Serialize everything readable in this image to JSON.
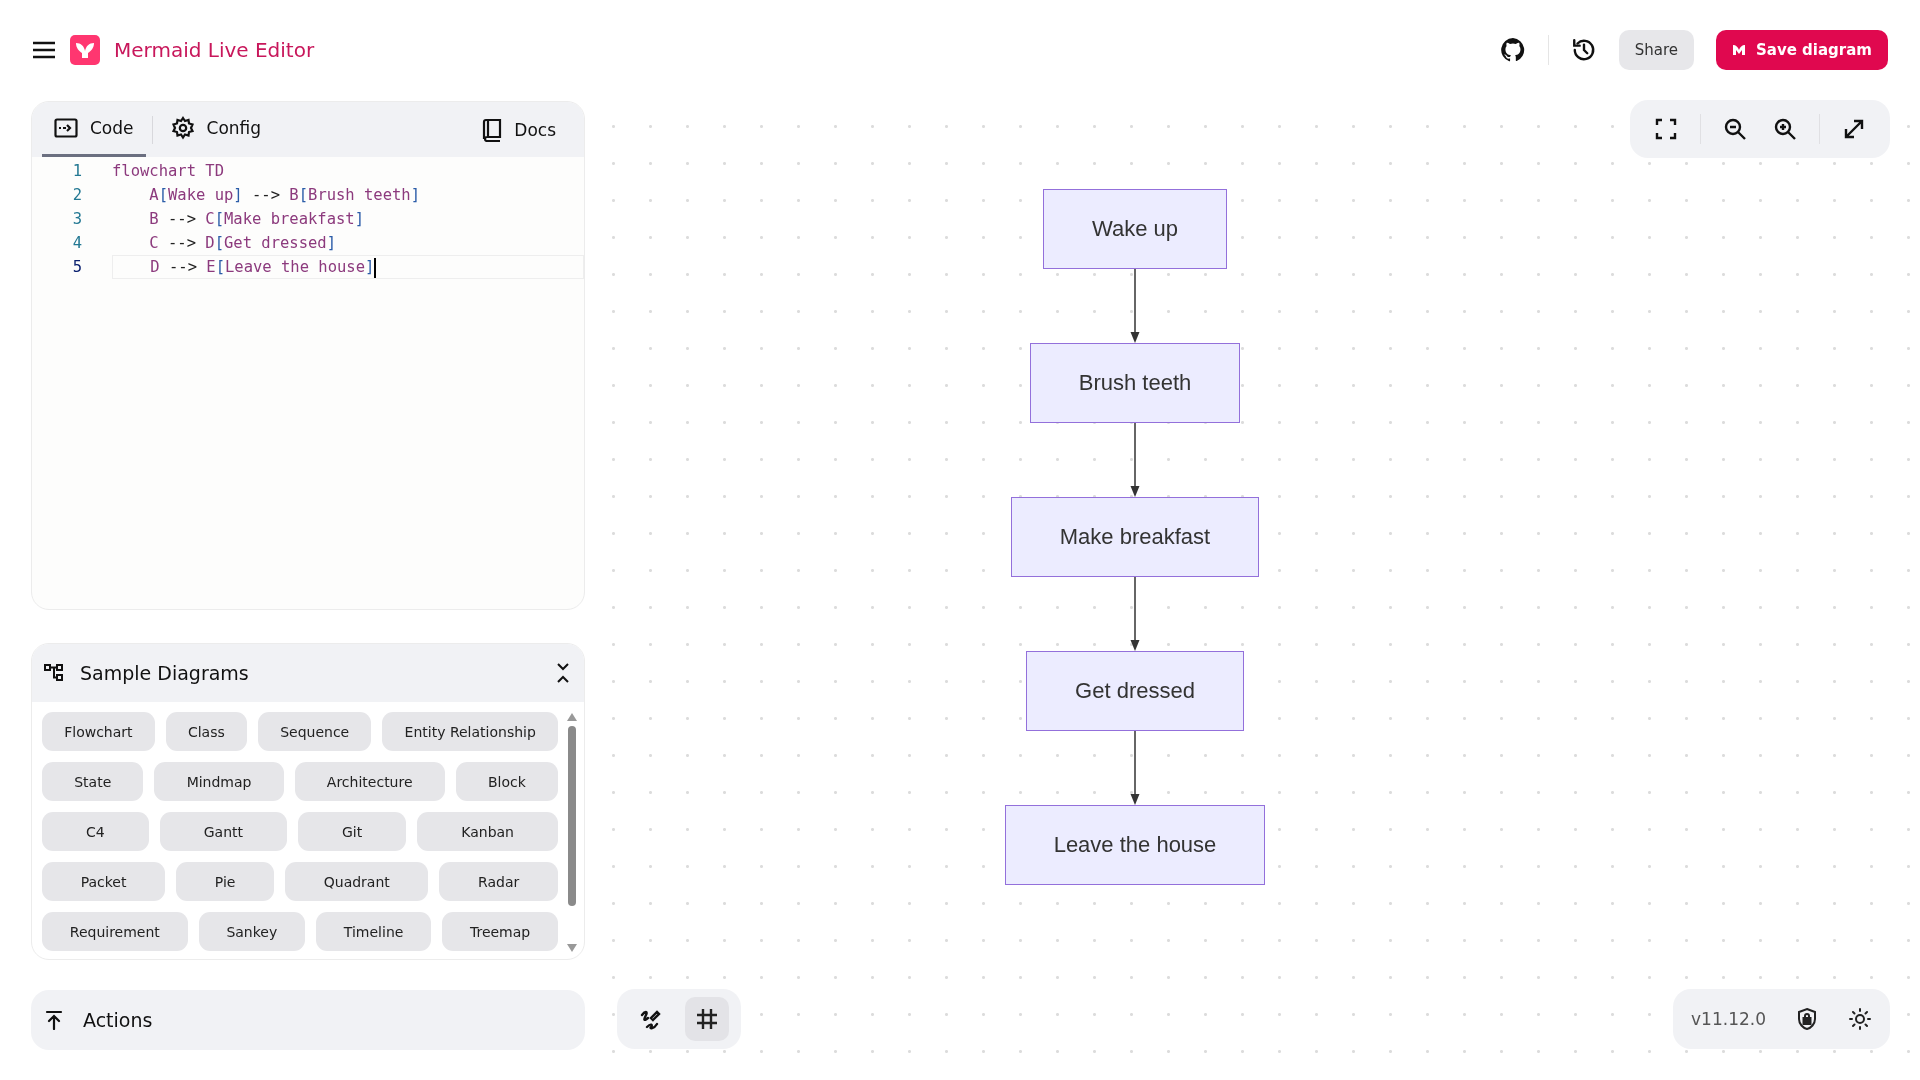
{
  "header": {
    "title": "Mermaid Live Editor",
    "share": "Share",
    "save": "Save diagram"
  },
  "editor": {
    "tabs": [
      {
        "label": "Code",
        "selected": true
      },
      {
        "label": "Config",
        "selected": false
      }
    ],
    "docs": "Docs",
    "lines": [
      {
        "number": "1",
        "text": "flowchart TD",
        "active": false
      },
      {
        "number": "2",
        "text": "    A[Wake up] --> B[Brush teeth]",
        "active": false
      },
      {
        "number": "3",
        "text": "    B --> C[Make breakfast]",
        "active": false
      },
      {
        "number": "4",
        "text": "    C --> D[Get dressed]",
        "active": false
      },
      {
        "number": "5",
        "text": "    D --> E[Leave the house]",
        "active": true
      }
    ]
  },
  "samples": {
    "title": "Sample Diagrams",
    "rows": [
      [
        "Flowchart",
        "Class",
        "Sequence",
        "Entity Relationship"
      ],
      [
        "State",
        "Mindmap",
        "Architecture",
        "Block"
      ],
      [
        "C4",
        "Gantt",
        "Git",
        "Kanban"
      ],
      [
        "Packet",
        "Pie",
        "Quadrant",
        "Radar"
      ],
      [
        "Requirement",
        "Sankey",
        "Timeline",
        "Treemap"
      ]
    ]
  },
  "actions": {
    "title": "Actions"
  },
  "diagram": {
    "nodes": [
      "Wake up",
      "Brush teeth",
      "Make breakfast",
      "Get dressed",
      "Leave the house"
    ]
  },
  "canvas_tools": {
    "grid_on": true
  },
  "footer": {
    "version": "v11.12.0"
  }
}
